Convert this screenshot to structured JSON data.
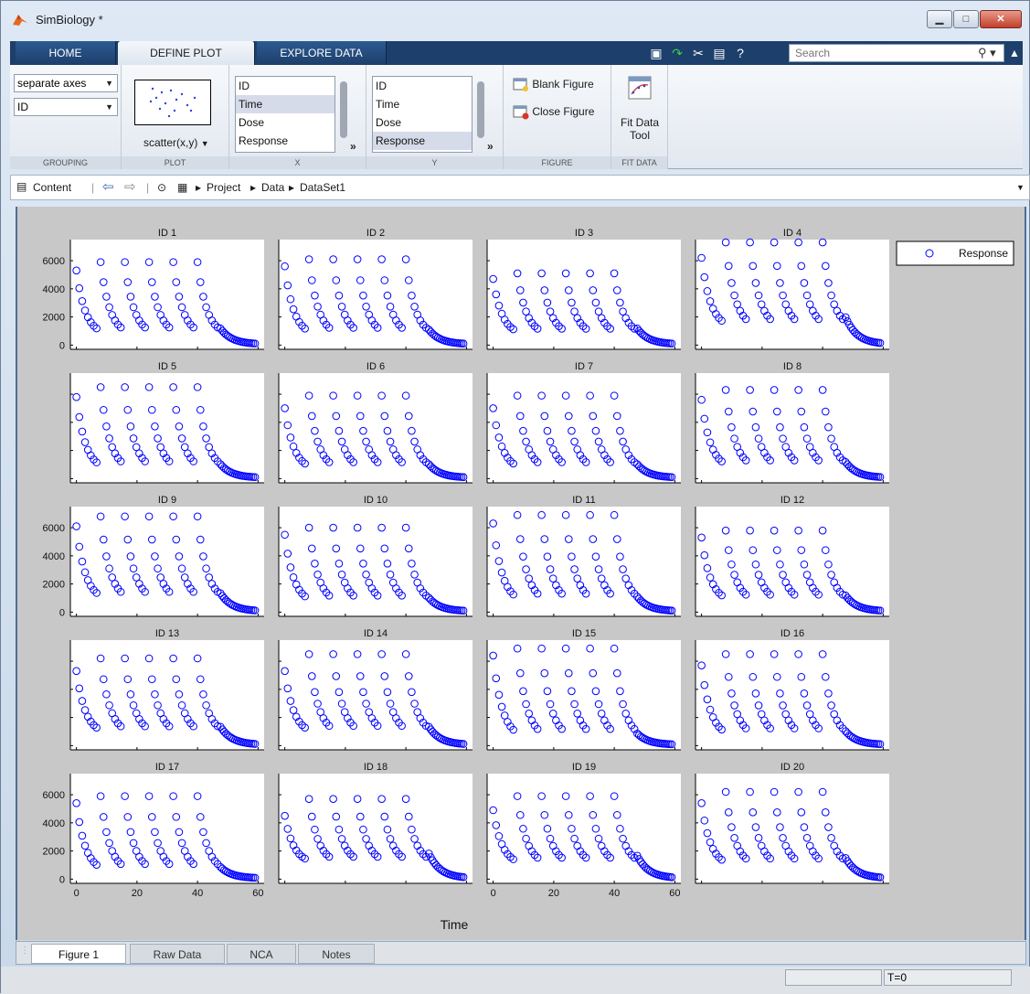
{
  "window": {
    "title": "SimBiology *"
  },
  "tabs": [
    {
      "label": "HOME",
      "active": false
    },
    {
      "label": "DEFINE PLOT",
      "active": true
    },
    {
      "label": "EXPLORE DATA",
      "active": false
    }
  ],
  "quick_access": [
    "save-icon",
    "undo-icon",
    "tools-icon",
    "window-icon",
    "help-icon"
  ],
  "search": {
    "placeholder": "Search"
  },
  "ribbon": {
    "grouping": {
      "label": "GROUPING",
      "layout": "separate axes",
      "group_by": "ID"
    },
    "plot": {
      "label": "PLOT",
      "type": "scatter(x,y)"
    },
    "x": {
      "label": "X",
      "items": [
        "ID",
        "Time",
        "Dose",
        "Response"
      ],
      "selected": "Time"
    },
    "y": {
      "label": "Y",
      "items": [
        "ID",
        "Time",
        "Dose",
        "Response"
      ],
      "selected": "Response"
    },
    "figure": {
      "label": "FIGURE",
      "blank": "Blank Figure",
      "close": "Close Figure"
    },
    "fitdata": {
      "label": "FIT DATA",
      "tool_line1": "Fit Data",
      "tool_line2": "Tool"
    }
  },
  "address": {
    "content": "Content",
    "crumbs": [
      "Project",
      "Data",
      "DataSet1"
    ]
  },
  "chart_data": {
    "type": "scatter",
    "layout": "grid 5x4",
    "xlabel": "Time",
    "ylabel": "",
    "xlim": [
      -2,
      62
    ],
    "ylim": [
      -300,
      7500
    ],
    "xticks": [
      0,
      20,
      40,
      60
    ],
    "yticks": [
      0,
      2000,
      4000,
      6000
    ],
    "legend": {
      "entries": [
        "Response"
      ],
      "placement": "top-right"
    },
    "marker_color": "#0000ff",
    "dose_times": [
      0,
      8,
      16,
      24,
      32,
      40
    ],
    "panels": [
      {
        "title": "ID 1",
        "peak": 5900,
        "first": 5300,
        "trough": 700
      },
      {
        "title": "ID 2",
        "peak": 6100,
        "first": 5600,
        "trough": 650
      },
      {
        "title": "ID 3",
        "peak": 5100,
        "first": 4700,
        "trough": 700
      },
      {
        "title": "ID 4",
        "peak": 7300,
        "first": 6200,
        "trough": 1200
      },
      {
        "title": "ID 5",
        "peak": 6500,
        "first": 5800,
        "trough": 600
      },
      {
        "title": "ID 6",
        "peak": 5900,
        "first": 5000,
        "trough": 600
      },
      {
        "title": "ID 7",
        "peak": 5900,
        "first": 5000,
        "trough": 600
      },
      {
        "title": "ID 8",
        "peak": 6300,
        "first": 5600,
        "trough": 700
      },
      {
        "title": "ID 9",
        "peak": 6800,
        "first": 6100,
        "trough": 800
      },
      {
        "title": "ID 10",
        "peak": 6000,
        "first": 5500,
        "trough": 600
      },
      {
        "title": "ID 11",
        "peak": 6900,
        "first": 6300,
        "trough": 650
      },
      {
        "title": "ID 12",
        "peak": 5800,
        "first": 5300,
        "trough": 700
      },
      {
        "title": "ID 13",
        "peak": 6200,
        "first": 5300,
        "trough": 800
      },
      {
        "title": "ID 14",
        "peak": 6500,
        "first": 5300,
        "trough": 800
      },
      {
        "title": "ID 15",
        "peak": 6900,
        "first": 6400,
        "trough": 500
      },
      {
        "title": "ID 16",
        "peak": 6500,
        "first": 5700,
        "trough": 600
      },
      {
        "title": "ID 17",
        "peak": 5900,
        "first": 5400,
        "trough": 500
      },
      {
        "title": "ID 18",
        "peak": 5700,
        "first": 4500,
        "trough": 1100
      },
      {
        "title": "ID 19",
        "peak": 5900,
        "first": 4900,
        "trough": 1000
      },
      {
        "title": "ID 20",
        "peak": 6200,
        "first": 5400,
        "trough": 900
      }
    ]
  },
  "doc_tabs": [
    {
      "label": "Figure 1",
      "active": true
    },
    {
      "label": "Raw Data",
      "active": false
    },
    {
      "label": "NCA",
      "active": false
    },
    {
      "label": "Notes",
      "active": false
    }
  ],
  "status": {
    "time": "T=0"
  }
}
